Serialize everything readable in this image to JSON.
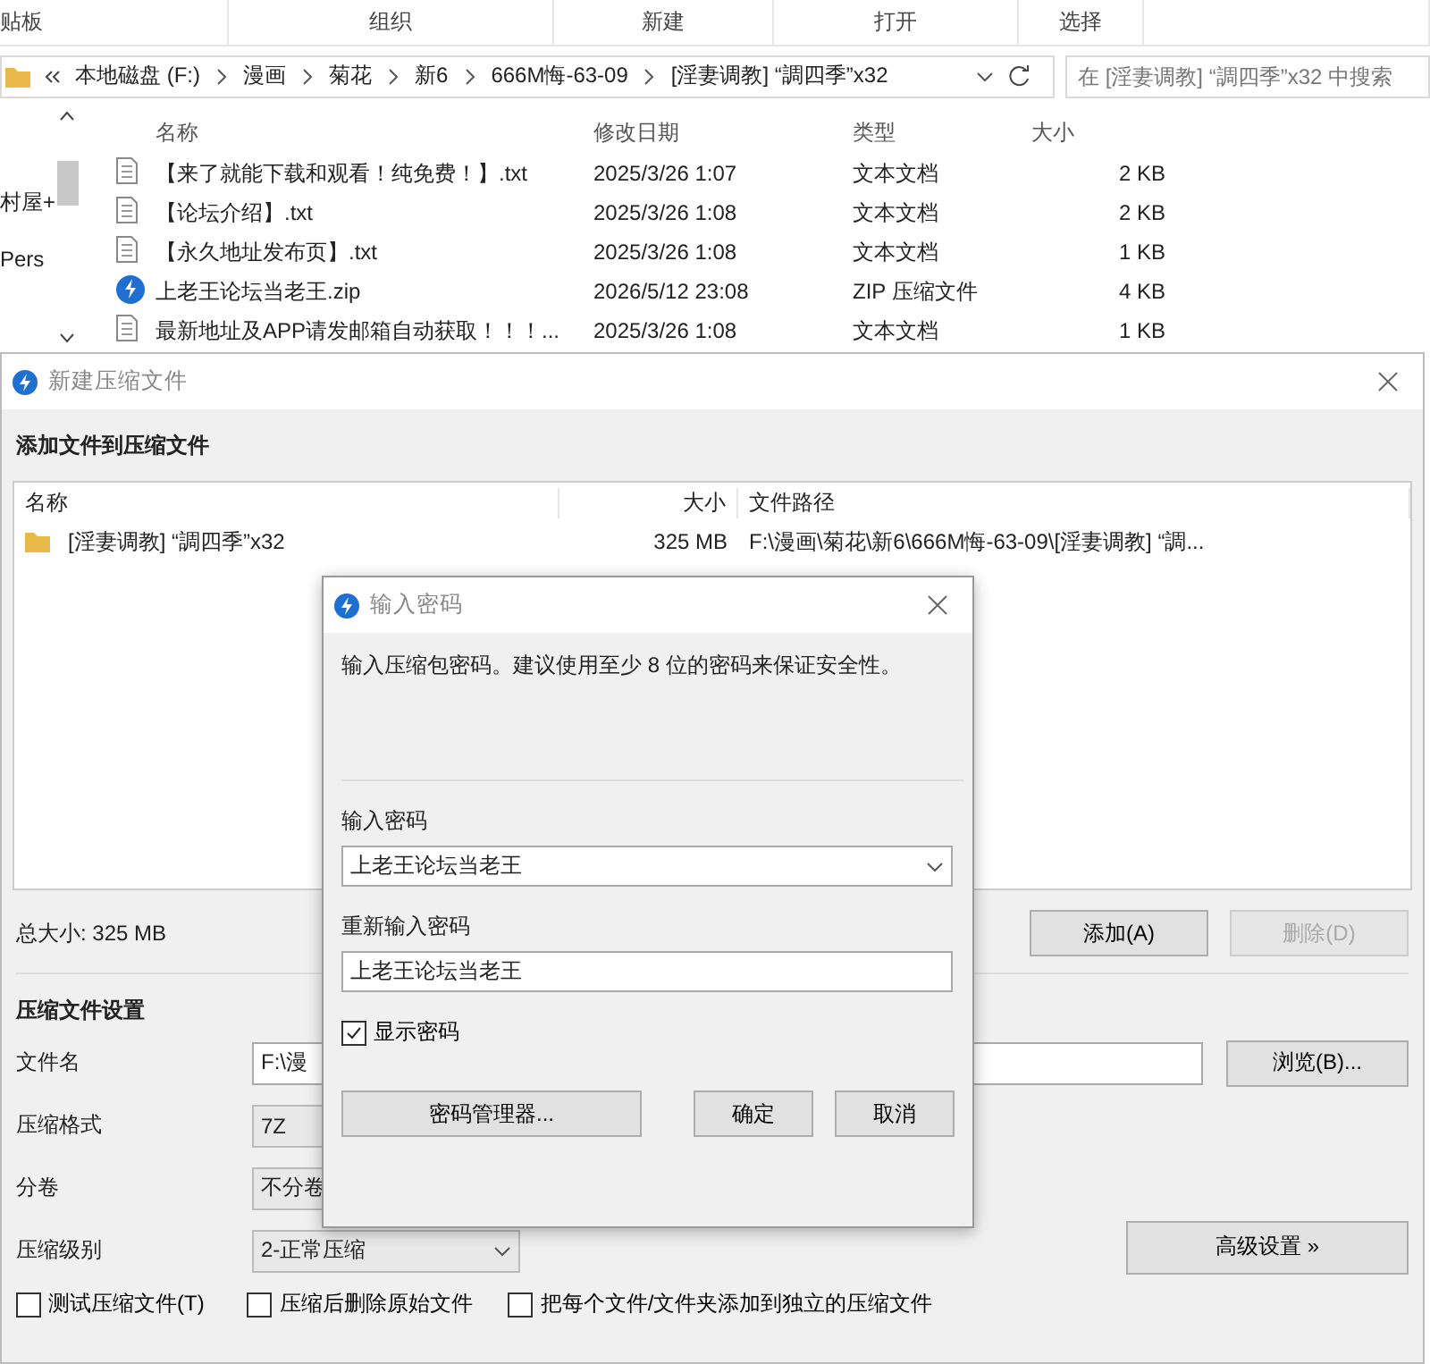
{
  "explorer": {
    "ribbon_groups": [
      "贴板",
      "组织",
      "新建",
      "打开",
      "选择"
    ],
    "breadcrumb": [
      "本地磁盘 (F:)",
      "漫画",
      "菊花",
      "新6",
      "666M悔-63-09",
      "[淫妻调教] “調四季”x32"
    ],
    "search": {
      "placeholder": "在 [淫妻调教] “調四季”x32 中搜索"
    },
    "nav_items": [
      "村屋+",
      "Pers"
    ],
    "columns": [
      "名称",
      "修改日期",
      "类型",
      "大小"
    ],
    "files": [
      {
        "name": "【来了就能下载和观看！纯免费！】.txt",
        "modified": "2025/3/26 1:07",
        "type": "文本文档",
        "size": "2 KB",
        "kind": "text"
      },
      {
        "name": "【论坛介绍】.txt",
        "modified": "2025/3/26 1:08",
        "type": "文本文档",
        "size": "2 KB",
        "kind": "text"
      },
      {
        "name": "【永久地址发布页】.txt",
        "modified": "2025/3/26 1:08",
        "type": "文本文档",
        "size": "1 KB",
        "kind": "text"
      },
      {
        "name": "上老王论坛当老王.zip",
        "modified": "2026/5/12 23:08",
        "type": "ZIP 压缩文件",
        "size": "4 KB",
        "kind": "zip"
      },
      {
        "name": "最新地址及APP请发邮箱自动获取！！！...",
        "modified": "2025/3/26 1:08",
        "type": "文本文档",
        "size": "1 KB",
        "kind": "text"
      }
    ]
  },
  "compress_dialog": {
    "title": "新建压缩文件",
    "section_files": "添加文件到压缩文件",
    "list_columns": [
      "名称",
      "大小",
      "文件路径"
    ],
    "list_rows": [
      {
        "name": "[淫妻调教] “調四季”x32",
        "size": "325 MB",
        "path": "F:\\漫画\\菊花\\新6\\666M悔-63-09\\[淫妻调教] “調..."
      }
    ],
    "total_size": "总大小: 325 MB",
    "list_buttons": [
      {
        "label": "添加(A)",
        "disabled": false
      },
      {
        "label": "删除(D)",
        "disabled": true
      }
    ],
    "section_settings": "压缩文件设置",
    "fields": [
      {
        "label": "文件名",
        "value": "F:\\漫",
        "kind": "text"
      },
      {
        "label": "压缩格式",
        "value": "7Z",
        "kind": "box"
      },
      {
        "label": "分卷",
        "value": "不分卷",
        "kind": "box"
      },
      {
        "label": "压缩级别",
        "value": "2-正常压缩",
        "kind": "select"
      }
    ],
    "browse_button": "浏览(B)...",
    "advanced_button": "高级设置 »",
    "options": [
      {
        "label": "测试压缩文件(T)",
        "checked": false
      },
      {
        "label": "压缩后删除原始文件",
        "checked": false
      },
      {
        "label": "把每个文件/文件夹添加到独立的压缩文件",
        "checked": false
      }
    ]
  },
  "password_dialog": {
    "title": "输入密码",
    "message": "输入压缩包密码。建议使用至少 8 位的密码来保证安全性。",
    "password_label": "输入密码",
    "password_value": "上老王论坛当老王",
    "confirm_label": "重新输入密码",
    "confirm_value": "上老王论坛当老王",
    "show_password": {
      "label": "显示密码",
      "checked": true
    },
    "buttons": [
      "密码管理器...",
      "确定",
      "取消"
    ]
  }
}
